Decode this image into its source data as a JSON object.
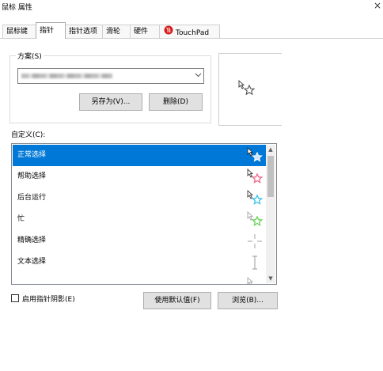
{
  "window": {
    "title": "鼠标 属性",
    "close_glyph": "×"
  },
  "tabs": [
    {
      "label": "鼠标键"
    },
    {
      "label": "指针"
    },
    {
      "label": "指针选项"
    },
    {
      "label": "滑轮"
    },
    {
      "label": "硬件"
    },
    {
      "label": "TouchPad",
      "icon": "touchpad-icon"
    }
  ],
  "scheme": {
    "label": "方案(S)",
    "value": "",
    "save_as_label": "另存为(V)...",
    "delete_label": "删除(D)"
  },
  "customize": {
    "label": "自定义(C):",
    "items": [
      {
        "label": "正常选择",
        "icon": "normal-select-cursor-icon",
        "selected": true
      },
      {
        "label": "帮助选择",
        "icon": "help-select-cursor-icon"
      },
      {
        "label": "后台运行",
        "icon": "working-in-background-cursor-icon"
      },
      {
        "label": "忙",
        "icon": "busy-cursor-icon"
      },
      {
        "label": "精确选择",
        "icon": "precision-select-cursor-icon"
      },
      {
        "label": "文本选择",
        "icon": "text-select-cursor-icon"
      }
    ]
  },
  "shadow_checkbox": {
    "label": "启用指针阴影(E)",
    "checked": false
  },
  "use_default_label": "使用默认值(F)",
  "browse_label": "浏览(B)...",
  "colors": {
    "selection": "#0078d7",
    "help_star": "#f06a8c",
    "background_star": "#3ec3e6",
    "busy_star": "#6ad25a",
    "touchpad_red": "#d81c1c"
  }
}
